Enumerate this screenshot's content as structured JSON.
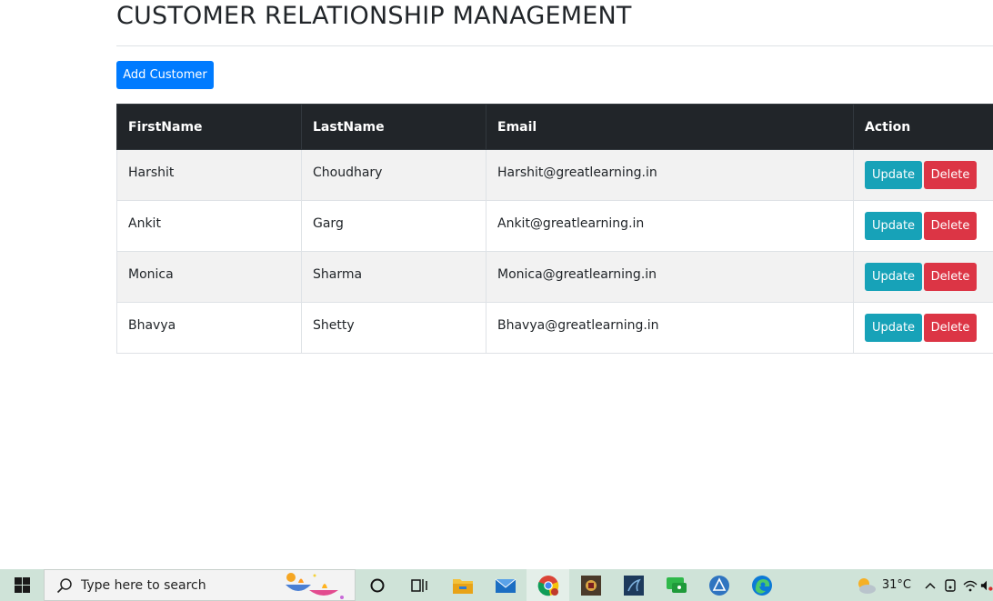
{
  "page": {
    "title": "CUSTOMER RELATIONSHIP MANAGEMENT",
    "add_button": "Add Customer"
  },
  "table": {
    "headers": [
      "FirstName",
      "LastName",
      "Email",
      "Action"
    ],
    "rows": [
      {
        "first": "Harshit",
        "last": "Choudhary",
        "email": "Harshit@greatlearning.in"
      },
      {
        "first": "Ankit",
        "last": "Garg",
        "email": "Ankit@greatlearning.in"
      },
      {
        "first": "Monica",
        "last": "Sharma",
        "email": "Monica@greatlearning.in"
      },
      {
        "first": "Bhavya",
        "last": "Shetty",
        "email": "Bhavya@greatlearning.in"
      }
    ],
    "update_label": "Update",
    "delete_label": "Delete"
  },
  "taskbar": {
    "search_placeholder": "Type here to search",
    "apps": [
      "cortana-icon",
      "task-view-icon",
      "file-explorer-icon",
      "mail-icon",
      "chrome-icon",
      "app-icon",
      "mysql-workbench-icon",
      "chat-icon",
      "git-icon",
      "edge-icon"
    ],
    "weather": {
      "temp": "31°C"
    }
  },
  "colors": {
    "primary": "#007bff",
    "info": "#17a2b8",
    "danger": "#dc3545",
    "dark": "#212529",
    "taskbar": "#cfe3d8"
  }
}
